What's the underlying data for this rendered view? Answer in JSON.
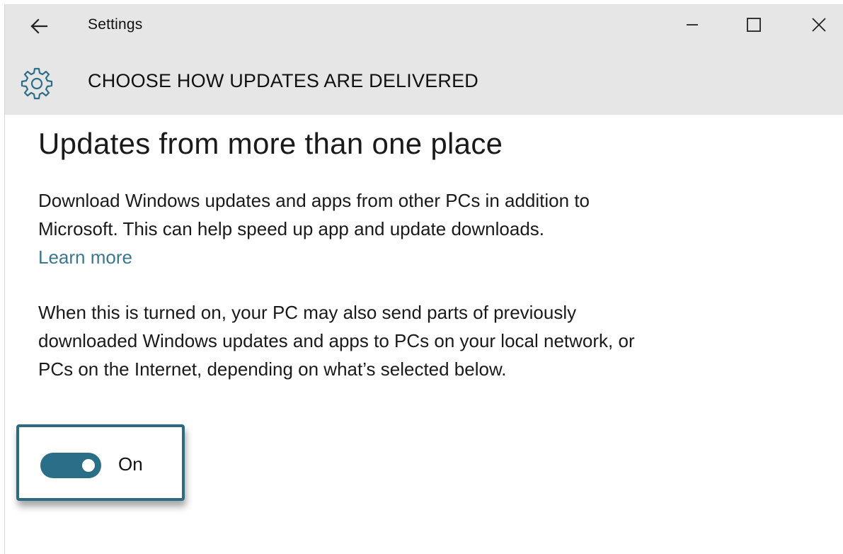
{
  "window": {
    "title": "Settings",
    "controls": {
      "minimize": "minimize-icon",
      "maximize": "maximize-icon",
      "close": "close-icon"
    }
  },
  "header": {
    "icon": "gear-icon",
    "title": "CHOOSE HOW UPDATES ARE DELIVERED"
  },
  "content": {
    "section_title": "Updates from more than one place",
    "paragraph1": "Download Windows updates and apps from other PCs in addition to Microsoft. This can help speed up app and update downloads.",
    "learn_more": "Learn more",
    "paragraph2": "When this is turned on, your PC may also send parts of previously downloaded Windows updates and apps to PCs on your local network, or PCs on the Internet, depending on what’s selected below."
  },
  "toggle": {
    "state": "On",
    "enabled": true
  },
  "colors": {
    "titlebar_bg": "#e6e6e6",
    "accent": "#2b6e88",
    "link": "#3a7790",
    "focus_border": "#2d6b83"
  }
}
